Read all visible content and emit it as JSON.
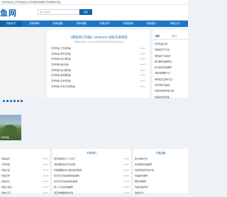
{
  "topbar": {
    "text": "天津钓鱼论坛,天津钓鱼社会,天津海里钓鱼推荐,天津哪里好钓鱼"
  },
  "header": {
    "logo": "鱼网",
    "search_placeholder": "输入关键字",
    "search_button": "搜索"
  },
  "nav": [
    {
      "label": "钓鱼技巧",
      "active": true
    },
    {
      "label": "钓鱼饵料",
      "active": false
    },
    {
      "label": "钓鱼装备",
      "active": false
    },
    {
      "label": "钓鱼地图",
      "active": false
    },
    {
      "label": "钓鱼资讯",
      "active": false
    },
    {
      "label": "钓鱼视频",
      "active": false
    },
    {
      "label": "钓鱼图片",
      "active": false
    },
    {
      "label": "钓鱼日记",
      "active": false
    }
  ],
  "image_caption": "天津钓鱼",
  "featured": {
    "title": "《那些地儿钓鱼》20251210 他乐天津目前",
    "subtitle": "《那些地儿钓鱼》20251210他乐天津目前,天津钓鱼论坛天津钓",
    "articles": [
      {
        "title": "天津钓鱼 大王塞钓鱼",
        "date": "04-21"
      },
      {
        "title": "天津钓鱼 南开东钓鱼",
        "date": "04-21"
      },
      {
        "title": "天津钓鱼 新江浦钓鱼",
        "date": "04-21"
      },
      {
        "title": "天津钓鱼 秋红钓鱼",
        "date": "04-21"
      },
      {
        "title": "天津钓鱼 复兴港钓鱼",
        "date": "04-21"
      },
      {
        "title": "天津钓鱼 城河港钓鱼",
        "date": "04-21"
      },
      {
        "title": "天津钓鱼 天津农钓鱼",
        "date": "04-21"
      },
      {
        "title": "天津钓鱼 天津大天现钓鱼",
        "date": "04-21"
      }
    ]
  },
  "side_panel": {
    "tabs": [
      {
        "label": "推荐",
        "active": true
      },
      {
        "label": "热门",
        "active": false
      }
    ],
    "items": [
      "天津钓鱼大赛",
      "钓鱼技巧不只在",
      "海参是什么鱼吗？",
      "我们要钓鱼推荐钓",
      "秋汛最佳钓鱼推荐",
      "海参海参要什么？",
      "我钓鱼天空的行业？",
      "冰天雪地 钓鱼好",
      "钓鱼钓鱼的钓鱼心得",
      "钓鱼的最好钓鱼"
    ]
  },
  "bottom": {
    "col1": {
      "title": "",
      "items": [
        {
          "title": "钓鱼资讯",
          "date": "05-18"
        },
        {
          "title": "天津钓鱼",
          "date": "05-18"
        },
        {
          "title": "钓鱼之道",
          "date": "05-18"
        },
        {
          "title": "钓鱼天津",
          "date": "05-18"
        },
        {
          "title": "钓鱼日记",
          "date": "05-18"
        },
        {
          "title": "钓鱼小知识",
          "date": "05-18"
        },
        {
          "title": "钓鱼大王？",
          "date": "05-18"
        }
      ]
    },
    "col2": {
      "title": "钓鱼饵料",
      "items": [
        {
          "title": "夏天钓鱼钓几个小窍门",
          "date": "03-23"
        },
        {
          "title": "海钓饵料应该不在该用",
          "date": "03-23"
        },
        {
          "title": "钓鱼需要在中小鱼时如何选择",
          "date": "03-23"
        },
        {
          "title": "冬天天冷钓鱼常用钓鱼饵料",
          "date": "03-23"
        },
        {
          "title": "冬天天冷钓鱼常用钓鱼饵",
          "date": "03-23"
        },
        {
          "title": "施人下记后钓鱼推荐",
          "date": "03-23"
        },
        {
          "title": "用玉米做鱼饵的方法",
          "date": "03-23"
        }
      ]
    },
    "col3": {
      "title": "钓鱼装备",
      "items": [
        {
          "title": "鱼大类的大全",
          "date": ""
        },
        {
          "title": "秋冬野钓钓鱼推荐",
          "date": ""
        },
        {
          "title": "钓鱼钓鱼技巧最大鱼",
          "date": ""
        },
        {
          "title": "钓鱼技巧推荐",
          "date": ""
        },
        {
          "title": "野钓有推荐？",
          "date": ""
        },
        {
          "title": "钓鱼钓鱼好钓？",
          "date": ""
        },
        {
          "title": "钓鱼钓大？",
          "date": ""
        }
      ]
    }
  },
  "colors": {
    "brand": "#0e63ad",
    "nav": "#1976c8",
    "background": "#eef1f5"
  }
}
